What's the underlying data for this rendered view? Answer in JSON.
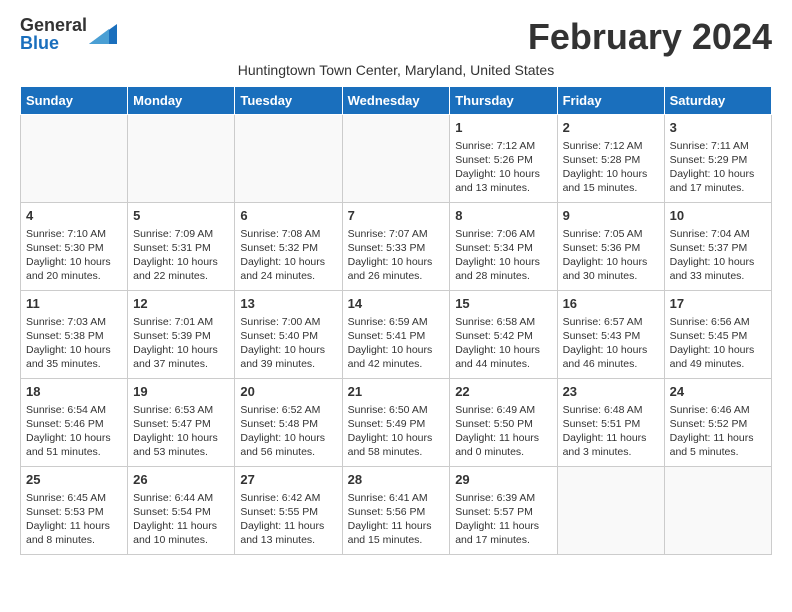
{
  "header": {
    "logo_general": "General",
    "logo_blue": "Blue",
    "month_title": "February 2024",
    "subtitle": "Huntingtown Town Center, Maryland, United States"
  },
  "days_of_week": [
    "Sunday",
    "Monday",
    "Tuesday",
    "Wednesday",
    "Thursday",
    "Friday",
    "Saturday"
  ],
  "weeks": [
    [
      {
        "day": "",
        "info": ""
      },
      {
        "day": "",
        "info": ""
      },
      {
        "day": "",
        "info": ""
      },
      {
        "day": "",
        "info": ""
      },
      {
        "day": "1",
        "info": "Sunrise: 7:12 AM\nSunset: 5:26 PM\nDaylight: 10 hours\nand 13 minutes."
      },
      {
        "day": "2",
        "info": "Sunrise: 7:12 AM\nSunset: 5:28 PM\nDaylight: 10 hours\nand 15 minutes."
      },
      {
        "day": "3",
        "info": "Sunrise: 7:11 AM\nSunset: 5:29 PM\nDaylight: 10 hours\nand 17 minutes."
      }
    ],
    [
      {
        "day": "4",
        "info": "Sunrise: 7:10 AM\nSunset: 5:30 PM\nDaylight: 10 hours\nand 20 minutes."
      },
      {
        "day": "5",
        "info": "Sunrise: 7:09 AM\nSunset: 5:31 PM\nDaylight: 10 hours\nand 22 minutes."
      },
      {
        "day": "6",
        "info": "Sunrise: 7:08 AM\nSunset: 5:32 PM\nDaylight: 10 hours\nand 24 minutes."
      },
      {
        "day": "7",
        "info": "Sunrise: 7:07 AM\nSunset: 5:33 PM\nDaylight: 10 hours\nand 26 minutes."
      },
      {
        "day": "8",
        "info": "Sunrise: 7:06 AM\nSunset: 5:34 PM\nDaylight: 10 hours\nand 28 minutes."
      },
      {
        "day": "9",
        "info": "Sunrise: 7:05 AM\nSunset: 5:36 PM\nDaylight: 10 hours\nand 30 minutes."
      },
      {
        "day": "10",
        "info": "Sunrise: 7:04 AM\nSunset: 5:37 PM\nDaylight: 10 hours\nand 33 minutes."
      }
    ],
    [
      {
        "day": "11",
        "info": "Sunrise: 7:03 AM\nSunset: 5:38 PM\nDaylight: 10 hours\nand 35 minutes."
      },
      {
        "day": "12",
        "info": "Sunrise: 7:01 AM\nSunset: 5:39 PM\nDaylight: 10 hours\nand 37 minutes."
      },
      {
        "day": "13",
        "info": "Sunrise: 7:00 AM\nSunset: 5:40 PM\nDaylight: 10 hours\nand 39 minutes."
      },
      {
        "day": "14",
        "info": "Sunrise: 6:59 AM\nSunset: 5:41 PM\nDaylight: 10 hours\nand 42 minutes."
      },
      {
        "day": "15",
        "info": "Sunrise: 6:58 AM\nSunset: 5:42 PM\nDaylight: 10 hours\nand 44 minutes."
      },
      {
        "day": "16",
        "info": "Sunrise: 6:57 AM\nSunset: 5:43 PM\nDaylight: 10 hours\nand 46 minutes."
      },
      {
        "day": "17",
        "info": "Sunrise: 6:56 AM\nSunset: 5:45 PM\nDaylight: 10 hours\nand 49 minutes."
      }
    ],
    [
      {
        "day": "18",
        "info": "Sunrise: 6:54 AM\nSunset: 5:46 PM\nDaylight: 10 hours\nand 51 minutes."
      },
      {
        "day": "19",
        "info": "Sunrise: 6:53 AM\nSunset: 5:47 PM\nDaylight: 10 hours\nand 53 minutes."
      },
      {
        "day": "20",
        "info": "Sunrise: 6:52 AM\nSunset: 5:48 PM\nDaylight: 10 hours\nand 56 minutes."
      },
      {
        "day": "21",
        "info": "Sunrise: 6:50 AM\nSunset: 5:49 PM\nDaylight: 10 hours\nand 58 minutes."
      },
      {
        "day": "22",
        "info": "Sunrise: 6:49 AM\nSunset: 5:50 PM\nDaylight: 11 hours\nand 0 minutes."
      },
      {
        "day": "23",
        "info": "Sunrise: 6:48 AM\nSunset: 5:51 PM\nDaylight: 11 hours\nand 3 minutes."
      },
      {
        "day": "24",
        "info": "Sunrise: 6:46 AM\nSunset: 5:52 PM\nDaylight: 11 hours\nand 5 minutes."
      }
    ],
    [
      {
        "day": "25",
        "info": "Sunrise: 6:45 AM\nSunset: 5:53 PM\nDaylight: 11 hours\nand 8 minutes."
      },
      {
        "day": "26",
        "info": "Sunrise: 6:44 AM\nSunset: 5:54 PM\nDaylight: 11 hours\nand 10 minutes."
      },
      {
        "day": "27",
        "info": "Sunrise: 6:42 AM\nSunset: 5:55 PM\nDaylight: 11 hours\nand 13 minutes."
      },
      {
        "day": "28",
        "info": "Sunrise: 6:41 AM\nSunset: 5:56 PM\nDaylight: 11 hours\nand 15 minutes."
      },
      {
        "day": "29",
        "info": "Sunrise: 6:39 AM\nSunset: 5:57 PM\nDaylight: 11 hours\nand 17 minutes."
      },
      {
        "day": "",
        "info": ""
      },
      {
        "day": "",
        "info": ""
      }
    ]
  ]
}
